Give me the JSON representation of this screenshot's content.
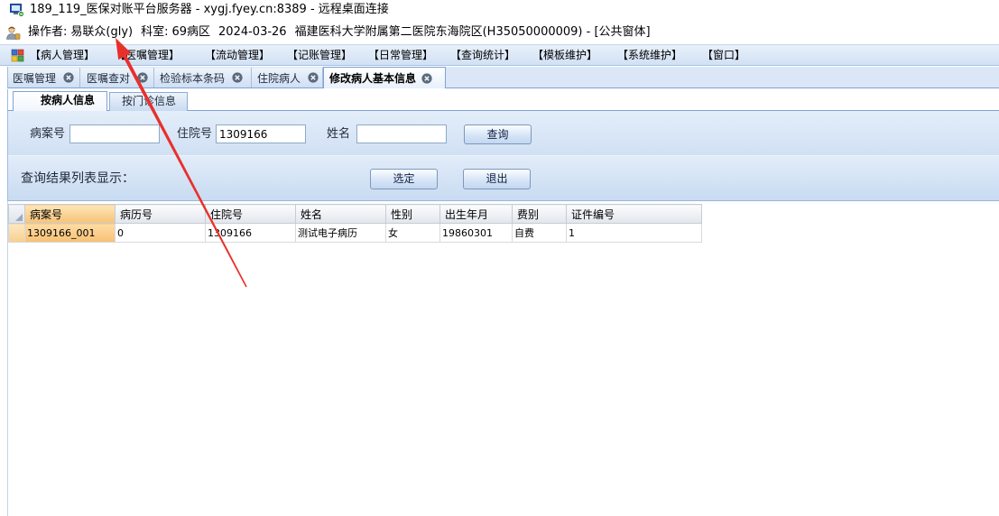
{
  "window": {
    "title": "189_119_医保对账平台服务器 - xygj.fyey.cn:8389 - 远程桌面连接"
  },
  "status": {
    "operator_label": "操作者:",
    "operator": "易联众(gly)",
    "dept_label": "科室:",
    "dept": "69病区",
    "date": "2024-03-26",
    "hospital": "福建医科大学附属第二医院东海院区(H35050000009) - [公共窗体]"
  },
  "menu": [
    "【病人管理】",
    "【医嘱管理】",
    "【流动管理】",
    "【记账管理】",
    "【日常管理】",
    "【查询统计】",
    "【模板维护】",
    "【系统维护】",
    "【窗口】"
  ],
  "tabs": [
    {
      "label": "医嘱管理",
      "active": false
    },
    {
      "label": "医嘱查对",
      "active": false
    },
    {
      "label": "检验标本条码",
      "active": false
    },
    {
      "label": "住院病人",
      "active": false
    },
    {
      "label": "修改病人基本信息",
      "active": true
    }
  ],
  "subtabs": [
    {
      "label": "按病人信息",
      "active": true
    },
    {
      "label": "按门诊信息",
      "active": false
    }
  ],
  "search": {
    "case_no_label": "病案号",
    "case_no_value": "",
    "inpatient_no_label": "住院号",
    "inpatient_no_value": "1309166",
    "name_label": "姓名",
    "name_value": "",
    "query_button": "查询"
  },
  "results": {
    "label": "查询结果列表显示：",
    "select_button": "选定",
    "exit_button": "退出"
  },
  "grid": {
    "columns": [
      "病案号",
      "病历号",
      "住院号",
      "姓名",
      "性别",
      "出生年月",
      "费别",
      "证件编号"
    ],
    "rows": [
      {
        "selected": true,
        "cells": [
          "1309166_001",
          "0",
          "1309166",
          "测试电子病历",
          "女",
          "19860301",
          "自费",
          "1"
        ]
      }
    ]
  },
  "icons": {
    "window": "remote-desktop-icon",
    "operator": "operator-icon",
    "menu": "app-menu-icon",
    "tab_close": "close-circle-icon",
    "grid_corner": "row-selector-icon",
    "annotation": "red-arrow"
  },
  "colors": {
    "annotation": "#e8302b",
    "selection": "#f8c174",
    "menu_bar": "#d2e1f4",
    "panel": "#d0e0f4",
    "tab_border": "#7fa2d4"
  }
}
